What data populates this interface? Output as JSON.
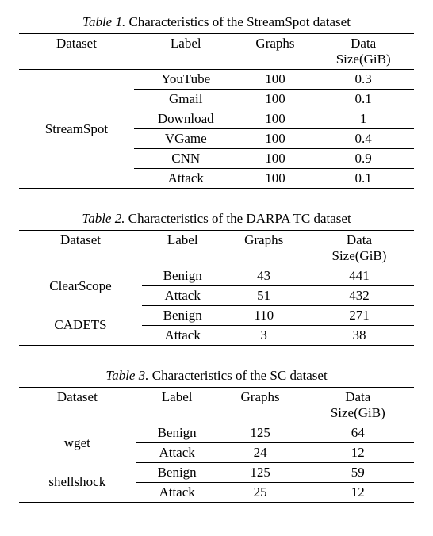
{
  "tables": [
    {
      "num": "Table 1.",
      "title": "Characteristics of the StreamSpot dataset",
      "headers": [
        "Dataset",
        "Label",
        "Graphs",
        "Data Size(GiB)"
      ],
      "sections": [
        {
          "dataset": "StreamSpot",
          "rows": [
            {
              "label": "YouTube",
              "graphs": "100",
              "size": "0.3"
            },
            {
              "label": "Gmail",
              "graphs": "100",
              "size": "0.1"
            },
            {
              "label": "Download",
              "graphs": "100",
              "size": "1"
            },
            {
              "label": "VGame",
              "graphs": "100",
              "size": "0.4"
            },
            {
              "label": "CNN",
              "graphs": "100",
              "size": "0.9"
            },
            {
              "label": "Attack",
              "graphs": "100",
              "size": "0.1"
            }
          ]
        }
      ]
    },
    {
      "num": "Table 2.",
      "title": "Characteristics of the DARPA TC dataset",
      "headers": [
        "Dataset",
        "Label",
        "Graphs",
        "Data Size(GiB)"
      ],
      "sections": [
        {
          "dataset": "ClearScope",
          "rows": [
            {
              "label": "Benign",
              "graphs": "43",
              "size": "441"
            },
            {
              "label": "Attack",
              "graphs": "51",
              "size": "432"
            }
          ]
        },
        {
          "dataset": "CADETS",
          "rows": [
            {
              "label": "Benign",
              "graphs": "110",
              "size": "271"
            },
            {
              "label": "Attack",
              "graphs": "3",
              "size": "38"
            }
          ]
        }
      ]
    },
    {
      "num": "Table 3.",
      "title": "Characteristics of the SC dataset",
      "headers": [
        "Dataset",
        "Label",
        "Graphs",
        "Data Size(GiB)"
      ],
      "sections": [
        {
          "dataset": "wget",
          "rows": [
            {
              "label": "Benign",
              "graphs": "125",
              "size": "64"
            },
            {
              "label": "Attack",
              "graphs": "24",
              "size": "12"
            }
          ]
        },
        {
          "dataset": "shellshock",
          "rows": [
            {
              "label": "Benign",
              "graphs": "125",
              "size": "59"
            },
            {
              "label": "Attack",
              "graphs": "25",
              "size": "12"
            }
          ]
        }
      ]
    }
  ]
}
